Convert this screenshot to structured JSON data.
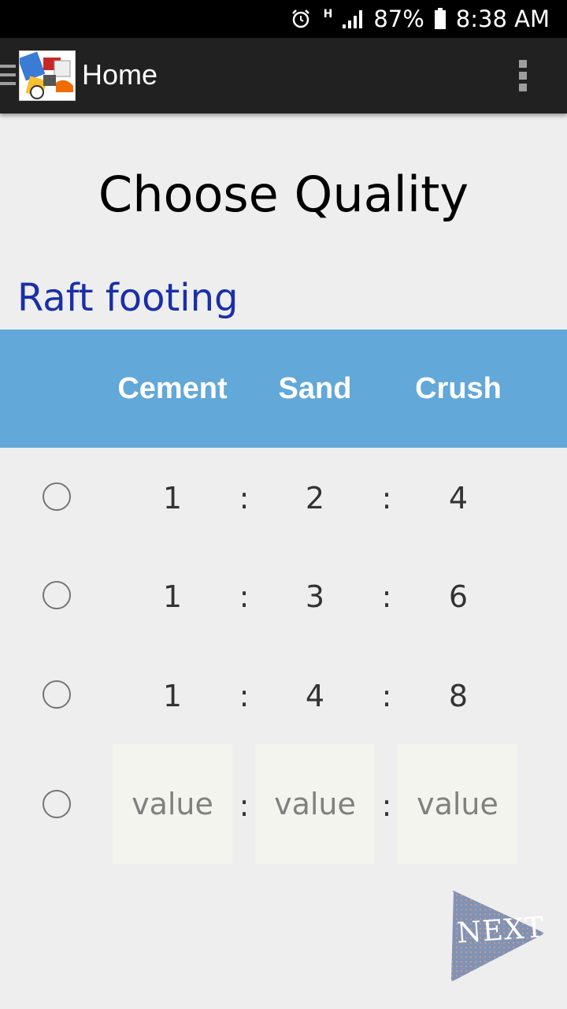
{
  "status_bar": {
    "network_type": "H",
    "battery_percent": "87%",
    "time": "8:38 AM",
    "icons": [
      "alarm-icon",
      "signal-icon",
      "battery-icon"
    ]
  },
  "app_bar": {
    "title": "Home",
    "icons": [
      "hamburger-menu-icon",
      "app-logo",
      "overflow-menu-icon"
    ]
  },
  "page": {
    "title": "Choose Quality",
    "section_title": "Raft footing"
  },
  "table": {
    "headers": [
      "Cement",
      "Sand",
      "Crush"
    ],
    "separator": ":",
    "rows": [
      [
        "1",
        "2",
        "4"
      ],
      [
        "1",
        "3",
        "6"
      ],
      [
        "1",
        "4",
        "8"
      ]
    ],
    "custom_row": {
      "placeholder": "value"
    }
  },
  "next_button": {
    "label": "NEXT"
  },
  "colors": {
    "header_band": "#62a8d9",
    "section_title": "#1a2fa8",
    "app_bar": "#212121"
  }
}
